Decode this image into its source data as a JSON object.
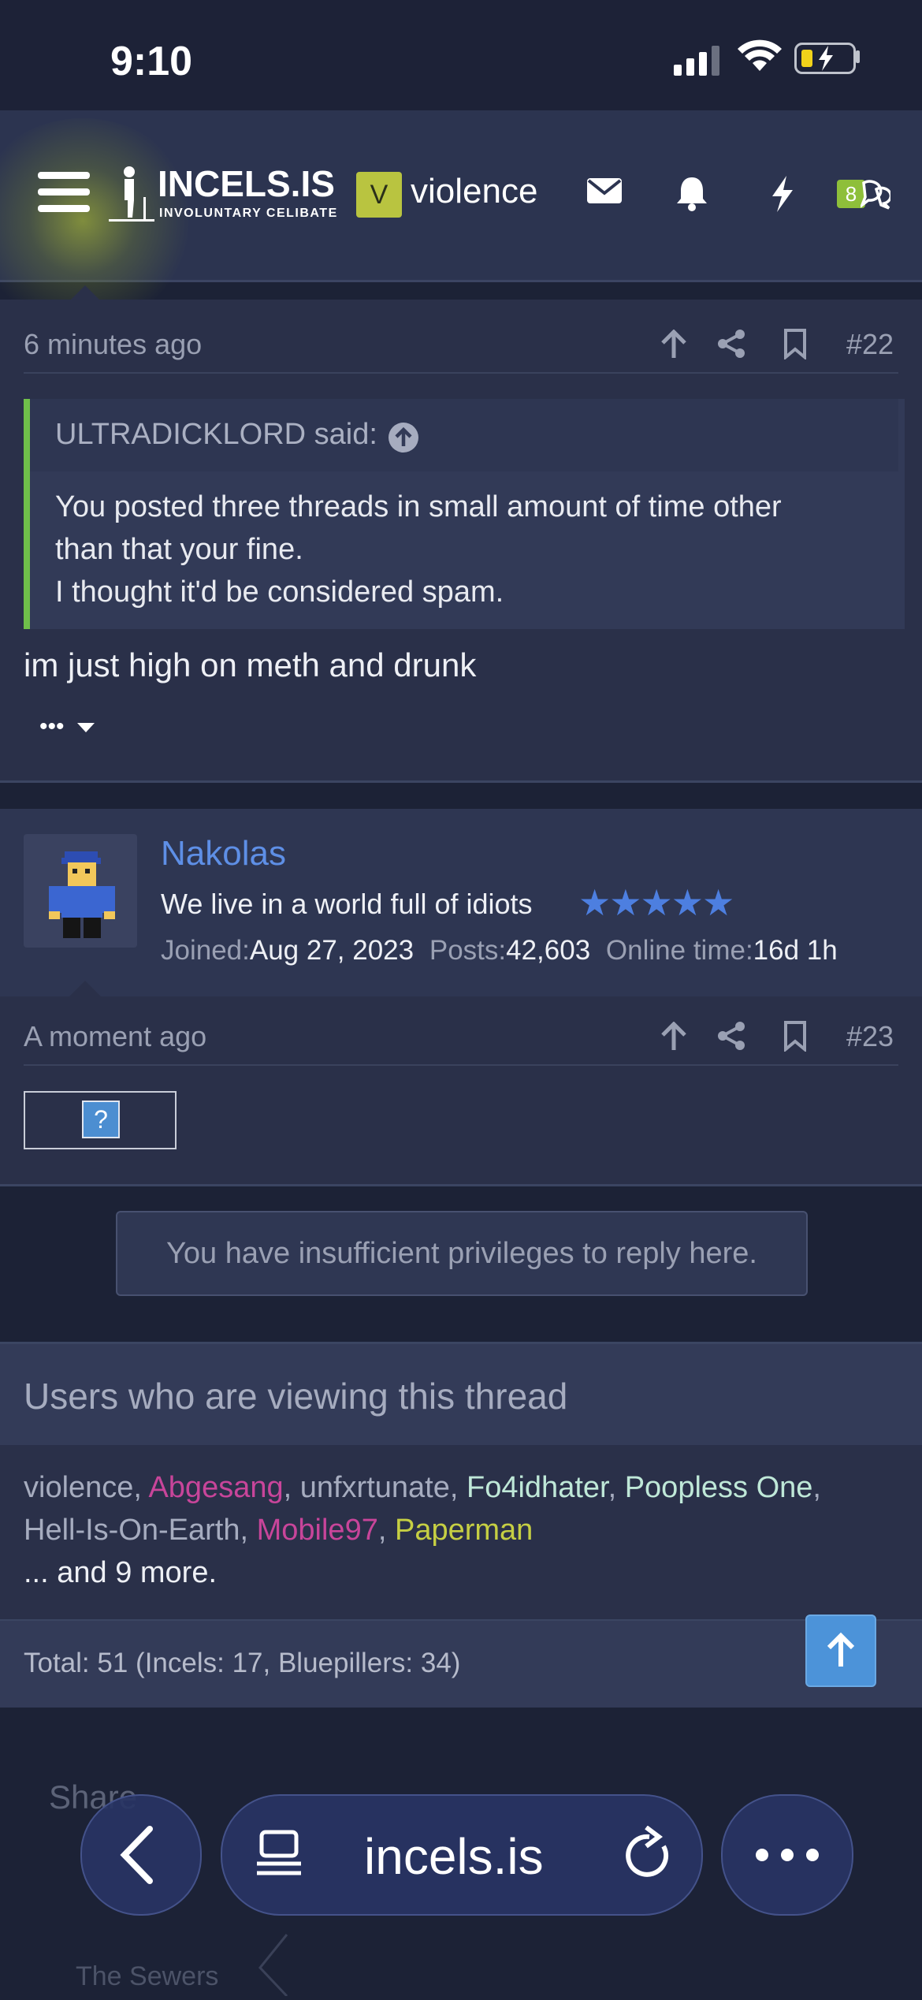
{
  "status": {
    "time": "9:10"
  },
  "header": {
    "logo_title": "INCELS.IS",
    "logo_subtitle": "INVOLUNTARY CELIBATE",
    "avatar_letter": "V",
    "username": "violence",
    "conversations_badge": "8",
    "icons": [
      "menu-icon",
      "envelope-icon",
      "bell-icon",
      "bolt-icon",
      "chat-icon"
    ]
  },
  "posts": [
    {
      "timestamp": "6 minutes ago",
      "number": "#22",
      "quote": {
        "attribution": "ULTRADICKLORD said:",
        "lines": [
          "You posted three threads in small amount of time other",
          "than that your fine.",
          "I thought it'd be considered spam."
        ]
      },
      "text": "im just high on meth and drunk",
      "more": "•••"
    },
    {
      "author": "Nakolas",
      "user_title": "We live in a world full of idiots",
      "stars": "★★★★★",
      "joined_label": "Joined:",
      "joined_value": "Aug 27, 2023",
      "posts_label": "Posts:",
      "posts_value": "42,603",
      "online_label": "Online time:",
      "online_value": "16d 1h",
      "timestamp": "A moment ago",
      "number": "#23",
      "broken_image": "?"
    }
  ],
  "reply_notice": "You have insufficient privileges to reply here.",
  "viewers": {
    "title": "Users who are viewing this thread",
    "users": [
      {
        "name": "violence",
        "color": "#a6acbf"
      },
      {
        "name": "Abgesang",
        "color": "#c8459a"
      },
      {
        "name": "unfxrtunate",
        "color": "#a6acbf"
      },
      {
        "name": "Fo4idhater",
        "color": "#bfe8d8"
      },
      {
        "name": "Poopless One",
        "color": "#bfe8d8"
      },
      {
        "name": "Hell-Is-On-Earth",
        "color": "#a6acbf"
      },
      {
        "name": "Mobile97",
        "color": "#c8459a"
      },
      {
        "name": "Paperman",
        "color": "#c6cf43"
      }
    ],
    "and_more": "... and 9 more.",
    "total": "Total: 51 (Incels: 17, Bluepillers: 34)"
  },
  "bottom": {
    "share_label": "Share",
    "breadcrumb": "The Sewers",
    "url": "incels.is"
  }
}
